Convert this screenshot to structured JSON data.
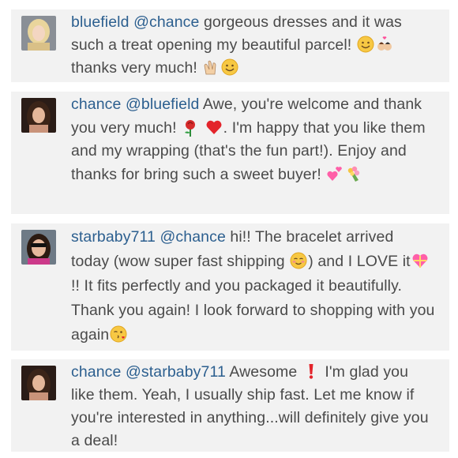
{
  "comments": [
    {
      "username": "bluefield",
      "mention": "@chance",
      "parts": [
        " gorgeous dresses and it was such a treat opening my beautiful parcel! ",
        " thanks very much! "
      ],
      "emoji": [
        "smile-emoji",
        "couple-heart-emoji",
        "clapping-hands-emoji",
        "smile-emoji"
      ]
    },
    {
      "username": "chance",
      "mention": "@bluefield",
      "parts": [
        " Awe, you're welcome and thank you very much! ",
        ". I'm happy that you like them and my wrapping (that's the fun part!). Enjoy and thanks for bring such a sweet buyer! "
      ],
      "emoji": [
        "rose-emoji",
        "red-heart-emoji",
        "two-hearts-emoji",
        "bouquet-emoji"
      ]
    },
    {
      "username": "starbaby711",
      "mention": "@chance",
      "parts": [
        " hi!! The bracelet arrived today (wow super fast shipping ",
        ") and I LOVE it",
        "!! It fits perfectly and you packaged it beautifully. Thank you again! I look forward to shopping with you again"
      ],
      "emoji": [
        "blush-emoji",
        "gift-heart-emoji",
        "kissing-face-emoji"
      ]
    },
    {
      "username": "chance",
      "mention": "@starbaby711",
      "parts": [
        " Awesome ",
        " I'm glad you like them. Yeah, I usually ship fast. Let me know if you're interested in anything...will definitely give you a deal!"
      ],
      "emoji": [
        "exclamation-emoji"
      ]
    }
  ],
  "colors": {
    "username": "#2c5f8f",
    "text": "#4a4a4a",
    "panel": "#f2f2f2"
  }
}
